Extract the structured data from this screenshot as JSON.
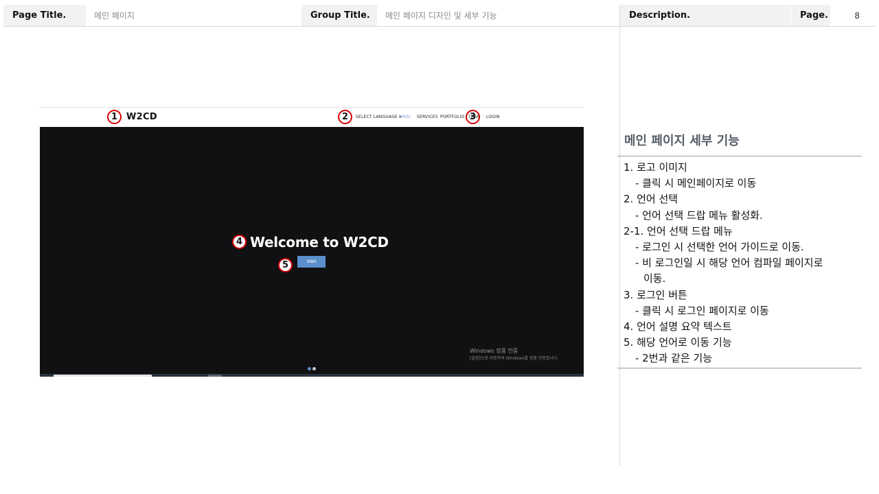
{
  "header": {
    "page_title_label": "Page Title.",
    "page_title_value": "메인 페이지",
    "group_title_label": "Group Title.",
    "group_title_value": "메인 페이지 디자인 및 세부 기능",
    "description_label": "Description.",
    "page_label": "Page.",
    "page_number": "8"
  },
  "mockup": {
    "logo": "W2CD",
    "nav": {
      "select_language": "SELECT LANGUAGE ▾",
      "main": "MAIN",
      "services": "SERVICES",
      "portfolio": "PORTFOLIO",
      "team": "TEAM",
      "login": "LOGIN"
    },
    "hero_title": "Welcome to W2CD",
    "start_button": "start",
    "windows_notice_title": "Windows 정품 인증",
    "windows_notice_sub": "[설정]으로 이동하여 Windows를 정품 인증합니다.",
    "colors": {
      "hero_bg": "#111114",
      "button": "#5b8fce",
      "active_nav": "#8a9ad8"
    }
  },
  "callouts": [
    "1",
    "2",
    "3",
    "4",
    "5"
  ],
  "panel": {
    "title": "메인 페이지 세부 기능",
    "lines": [
      "1. 로고 이미지",
      "- 클릭 시 메인페이지로 이동",
      "2. 언어 선택",
      "- 언어 선택 드랍 메뉴 활성화.",
      "2-1. 언어 선택 드랍 메뉴",
      "- 로그인 시 선택한 언어 가이드로 이동.",
      "- 비 로그인일 시 해당 언어 컴파일 페이지로",
      "이동.",
      "3. 로그인 버튼",
      "- 클릭 시 로그인 페이지로 이동",
      "4. 언어 설명 요약 텍스트",
      "5. 해당 언어로 이동 기능",
      "- 2번과 같은 기능"
    ]
  }
}
